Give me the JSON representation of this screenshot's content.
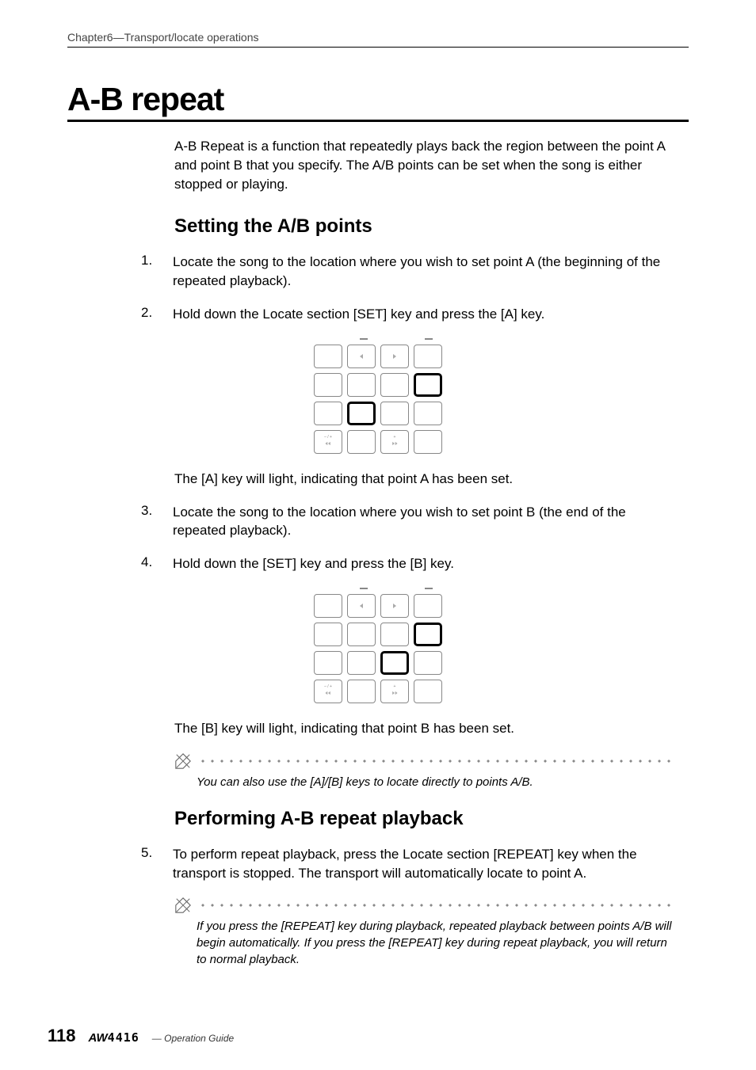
{
  "header": {
    "chapter": "Chapter6—Transport/locate operations"
  },
  "title": "A-B repeat",
  "intro": "A-B Repeat is a function that repeatedly plays back the region between the point A and point B that you specify. The A/B points can be set when the song is either stopped or playing.",
  "section1": {
    "heading": "Setting the A/B points",
    "steps": [
      {
        "num": "1.",
        "text": "Locate the song to the location where you wish to set point A (the beginning of the repeated playback)."
      },
      {
        "num": "2.",
        "text": "Hold down the Locate section [SET] key and press the [A] key."
      }
    ],
    "result1": "The [A] key will light, indicating that point A has been set.",
    "steps2": [
      {
        "num": "3.",
        "text": "Locate the song to the location where you wish to set point B (the end of the repeated playback)."
      },
      {
        "num": "4.",
        "text": "Hold down the [SET] key and press the [B] key."
      }
    ],
    "result2": "The [B] key will light, indicating that point B has been set.",
    "tip1": "You can also use the [A]/[B] keys to locate directly to points A/B."
  },
  "section2": {
    "heading": "Performing A-B repeat playback",
    "steps": [
      {
        "num": "5.",
        "text": "To perform repeat playback, press the Locate section [REPEAT] key when the transport is stopped. The transport will automatically locate to point A."
      }
    ],
    "tip1": "If you press the [REPEAT] key during playback, repeated playback between points A/B will begin automatically. If you press the [REPEAT] key during repeat playback, you will return to normal playback."
  },
  "footer": {
    "page_number": "118",
    "product_prefix": "AW",
    "product_model": "4416",
    "guide_label": "— Operation Guide"
  },
  "keypad": {
    "rew_label": "– / +",
    "ff_label": "+"
  }
}
